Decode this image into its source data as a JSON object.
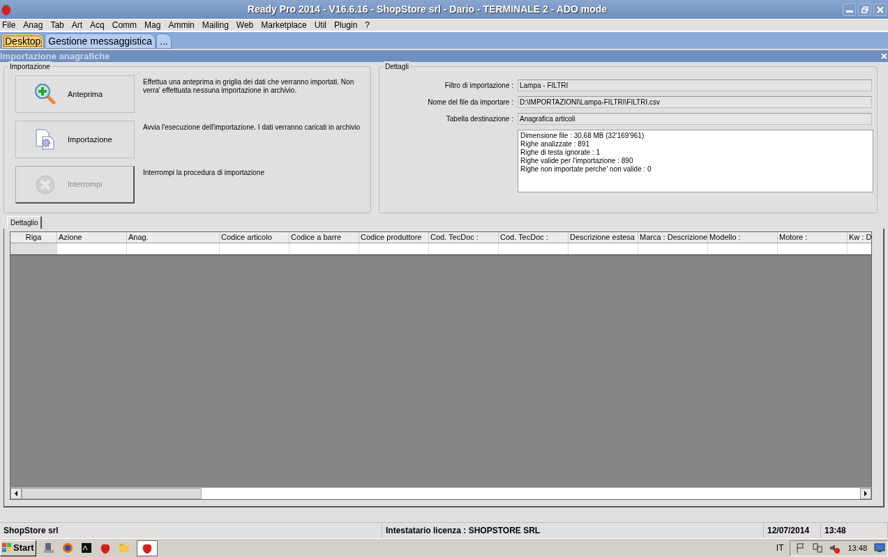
{
  "window": {
    "title": "Ready Pro 2014 - V16.6.16 - ShopStore srl - Dario - TERMINALE 2 - ADO mode"
  },
  "menu": [
    "File",
    "Anag",
    "Tab",
    "Art",
    "Acq",
    "Comm",
    "Mag",
    "Ammin",
    "Mailing",
    "Web",
    "Marketplace",
    "Util",
    "Plugin",
    "?"
  ],
  "tabs": [
    {
      "label": "Desktop",
      "selected": true
    },
    {
      "label": "Gestione messaggistica",
      "selected": false
    },
    {
      "label": "...",
      "selected": false
    }
  ],
  "subwindow": {
    "title": "Importazione anagrafiche"
  },
  "import_group": {
    "title": "Importazione",
    "actions": [
      {
        "kind": "preview",
        "label": "Anteprima",
        "description": "Effettua una anteprima in griglia dei dati che verranno importati. Non verra' effettuata nessuna importazione in archivio.",
        "disabled": false
      },
      {
        "kind": "import",
        "label": "Importazione",
        "description": "Avvia l'esecuzione dell'importazione. I dati verranno caricati in archivio",
        "disabled": false
      },
      {
        "kind": "stop",
        "label": "Interrompi",
        "description": "Interrompi la procedura di importazione",
        "disabled": true
      }
    ]
  },
  "details_group": {
    "title": "Dettagli",
    "fields": [
      {
        "label": "Filtro di importazione :",
        "value": "Lampa - FILTRI"
      },
      {
        "label": "Nome del file da importare :",
        "value": "D:\\IMPORTAZIONI\\Lampa-FILTRI\\FILTRI.csv"
      },
      {
        "label": "Tabella destinazione :",
        "value": "Anagrafica articoli"
      }
    ],
    "summary": [
      "Dimensione file : 30,68 MB (32'169'961)",
      "Righe analizzate : 891",
      "Righe di testa ignorate : 1",
      "Righe valide per l'importazione : 890",
      "Righe non importate perche' non valide : 0"
    ]
  },
  "detail_tab": {
    "label": "Dettaglio"
  },
  "grid": {
    "columns": [
      "Riga",
      "Azione",
      "Anag.",
      "Codice articolo",
      "Codice a barre",
      "Codice produttore",
      "Cod. TecDoc :",
      "Cod. TecDoc :",
      "Descrizione estesa",
      "Marca : Descrizione",
      "Modello :",
      "Motore :",
      "Kw : D"
    ]
  },
  "status_bar": {
    "company": "ShopStore srl",
    "license": "Intestatario licenza : SHOPSTORE SRL",
    "date": "12/07/2014",
    "time": "13:48"
  },
  "taskbar": {
    "start": "Start",
    "language": "IT",
    "clock": "13:48"
  }
}
